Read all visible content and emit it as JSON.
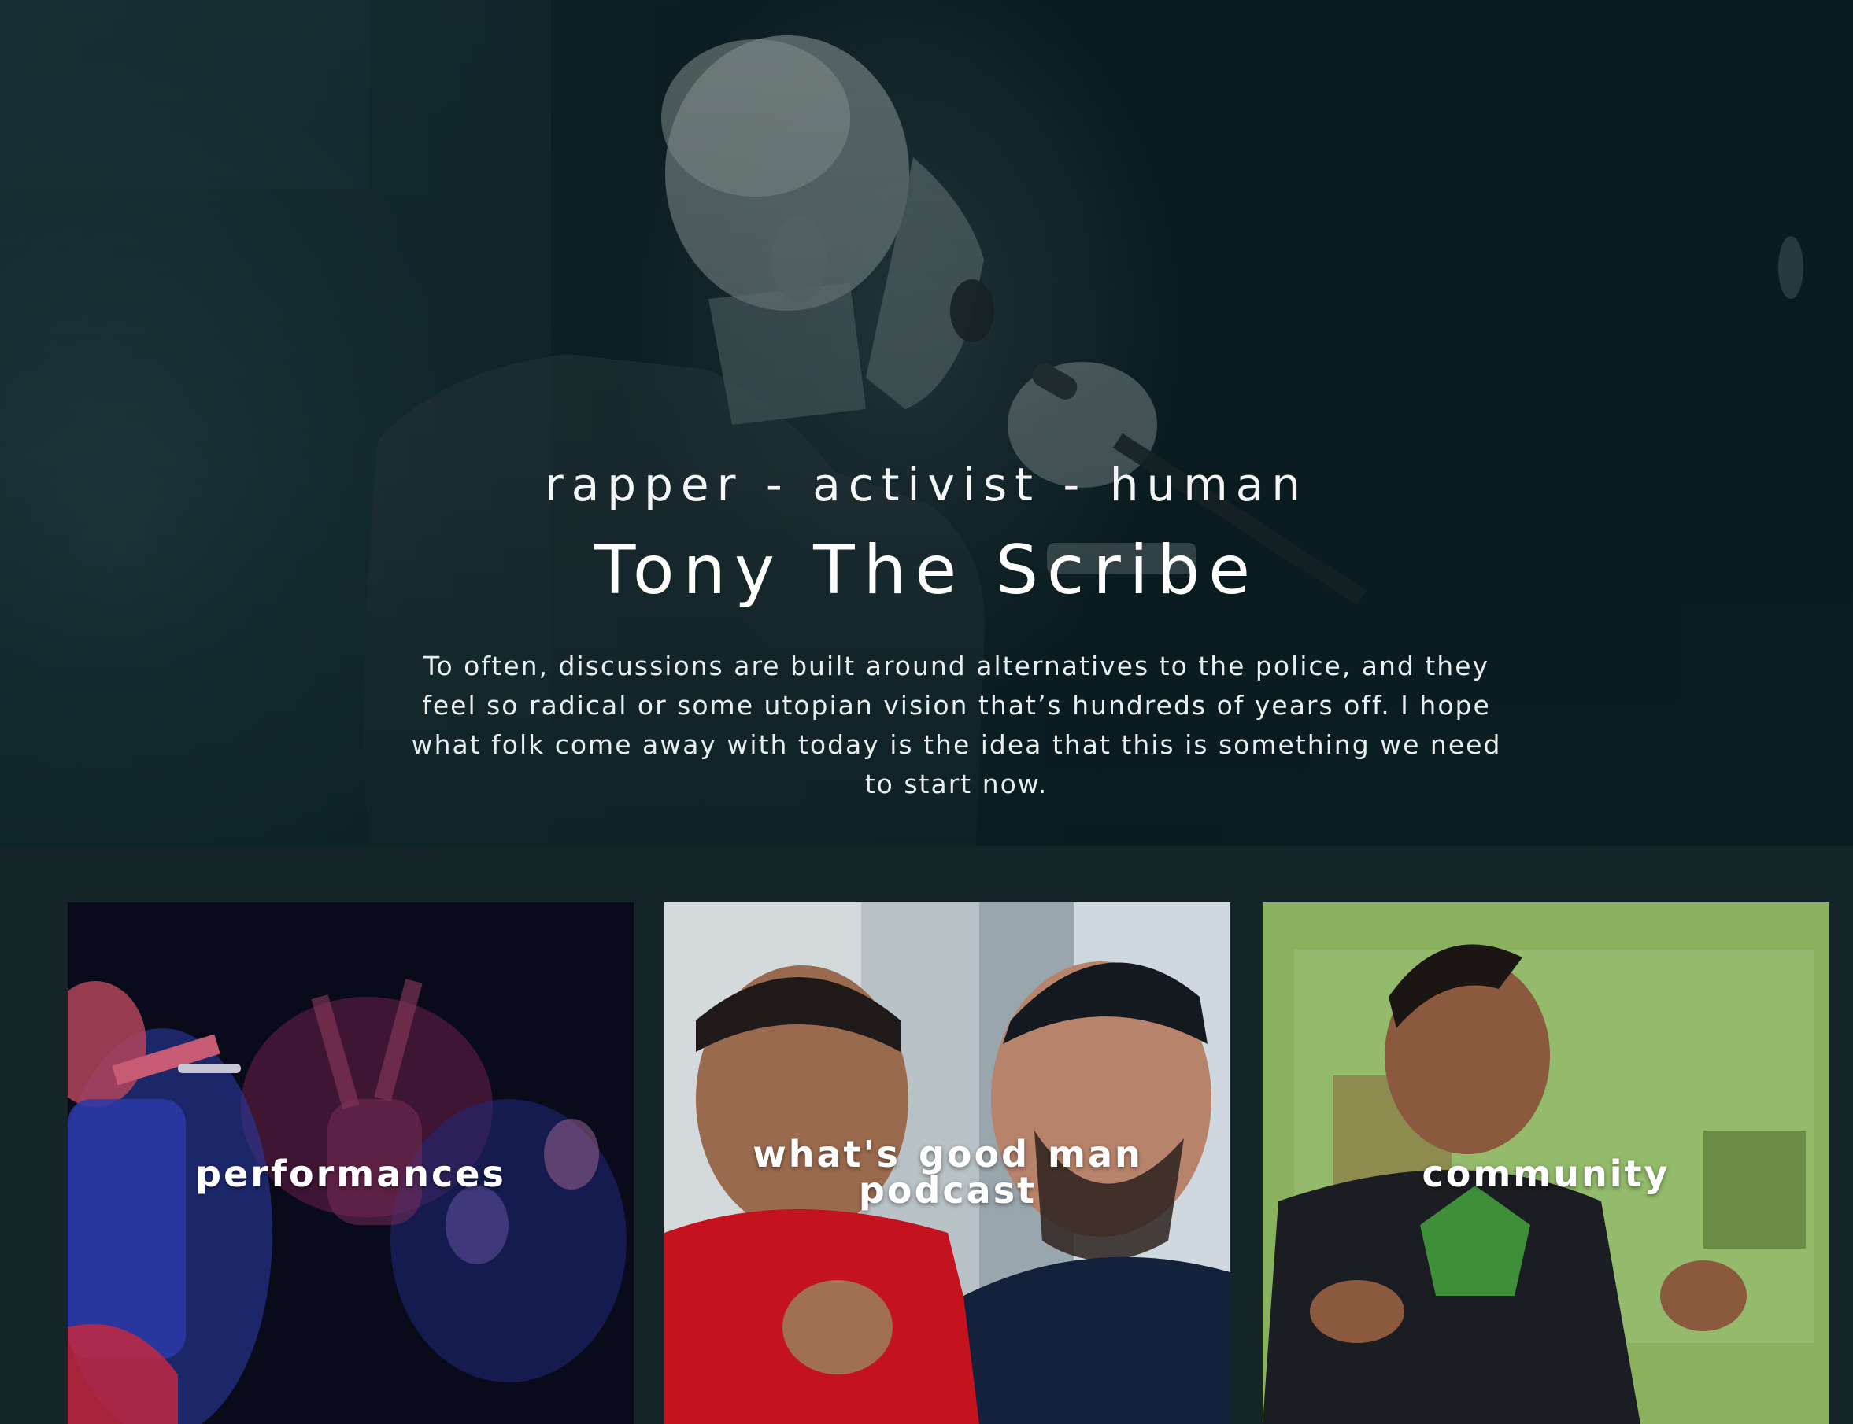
{
  "hero": {
    "tagline": "rapper - activist - human",
    "name": "Tony The Scribe",
    "quote": "To often, discussions are built around alternatives to the police, and they feel so radical or some utopian vision that’s hundreds of years off. I hope what folk come away with today is the idea that this is something we need to start now."
  },
  "cards": [
    {
      "label": "performances"
    },
    {
      "label": "what's good man podcast"
    },
    {
      "label": "community"
    }
  ],
  "colors": {
    "page_background": "#152427",
    "hero_tint": "#0c1e22",
    "text": "#ffffff"
  }
}
